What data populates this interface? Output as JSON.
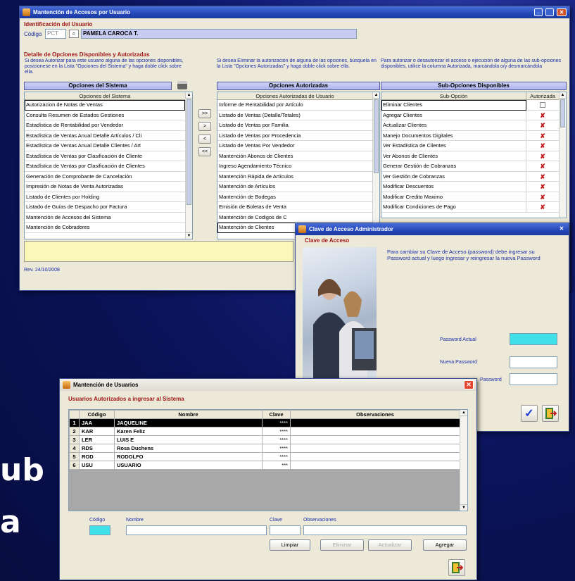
{
  "background": {
    "fragment1": "ub",
    "fragment2": "a"
  },
  "w1": {
    "title": "Mantención de Accesos por Usuario",
    "id_section": "Identificación del Usuario",
    "codigo_label": "Código",
    "codigo_value": "PCT",
    "user_name": "PAMELA CAROCA T.",
    "detail_section": "Detalle de Opciones Disponibles y Autorizadas",
    "help1": "Si desea Autorizar para este usuario alguna de las opciones disponibles, posicionese en la Lista \"Opciones del Sistema\" y haga doble click sobre ella.",
    "help2": "Si desea Eliminar la autorización de alguna de las opciones, búsquela en la Lista \"Opciones Autorizadas\" y haga doble click sobre ella.",
    "help3": "Para autorizar o desautorizar el acceso o ejecución de alguna de las sub-opciones disponibles, utilice la columna Autorizada, marcándola o/y desmarcándola",
    "hdr_sistema": "Opciones del Sistema",
    "hdr_autorizadas": "Opciones Autorizadas",
    "hdr_sub": "Sub-Opciones Disponibles",
    "col_sistema": "Opciones del Sistema",
    "col_aut": "Opciones Autorizadas de Usuario",
    "col_sub": "Sub-Opción",
    "col_autorizada": "Autorizada",
    "sistema": [
      "Autorizacion de Notas de Ventas",
      "Consulta Resumen de Estados Gestiones",
      "Estadística de Rentabilidad por Vendedor",
      "Estadística de Ventas Anual Detalle Artículos / Cli",
      "Estadística de Ventas Anual Detalle Clientes / Art",
      "Estadística de Ventas por Clasificación de Cliente",
      "Estadística de Ventas por Clasificación de Clientes",
      "Generación de Comprobante de Cancelación",
      "Impresión de Notas de Venta Autorizadas",
      "Listado de Clientes por Holding",
      "Listado de Guías de Despacho por Factura",
      "Mantención de Accesos del Sistema",
      "Mantención de Cobradores"
    ],
    "autorizadas": [
      "Informe de Rentabilidad por Artículo",
      "Listado de Ventas (Detalle/Totales)",
      "Listado de Ventas por Familia",
      "Listado de Ventas por Procedencia",
      "Listado de Ventas Por Vendedor",
      "Mantención Abonos de Clientes",
      "Ingreso Agendamiento Técnico",
      "Mantención Rápida de Artículos",
      "Mantención de Artículos",
      "Mantención de Bodegas",
      "Emisión de Boletas de Venta",
      "Mantención de Codigos de C",
      "Mantención de Clientes"
    ],
    "sub": [
      "Eliminar Clientes",
      "Agregar Clientes",
      "Actualizar Clientes",
      "Manejo Documentos Digitales",
      "Ver Estadística de Clientes",
      "Ver Abonos de Clientes",
      "Generar Gestión de Cobranzas",
      "Ver Gestión de Cobranzas",
      "Modificar Descuentos",
      "Modificar Credito Maximo",
      "Modificar Condiciones de Pago"
    ],
    "sub_mark": [
      "",
      "✘",
      "✘",
      "✘",
      "✘",
      "✘",
      "✘",
      "✘",
      "✘",
      "✘",
      "✘"
    ],
    "btn_all_add": ">>",
    "btn_add": ">",
    "btn_remove": "<",
    "btn_all_remove": "<<",
    "revision": "Rev. 24/10/2008"
  },
  "w2": {
    "title": "Clave de Acceso Administrador",
    "section": "Clave de Acceso",
    "instructions": "Para cambiar su Clave de Acceso (password) debe ingresar su Password actual y luego ingresar y reingresar la nueva Password",
    "lbl_actual": "Password Actual",
    "lbl_nueva": "Nueva Password",
    "lbl_repite": "Password"
  },
  "w3": {
    "title": "Mantención de Usuarios",
    "section": "Usuarios Autorizados a ingresar al Sistema",
    "cols": [
      "Código",
      "Nombre",
      "Clave",
      "Observaciones"
    ],
    "rows": [
      {
        "n": "1",
        "codigo": "JAA",
        "nombre": "JAQUELINE",
        "clave": "****",
        "obs": ""
      },
      {
        "n": "2",
        "codigo": "KAR",
        "nombre": "Karen Feliz",
        "clave": "****",
        "obs": ""
      },
      {
        "n": "3",
        "codigo": "LER",
        "nombre": "LUIS E",
        "clave": "****",
        "obs": ""
      },
      {
        "n": "4",
        "codigo": "RDS",
        "nombre": "Rosa Duchens",
        "clave": "****",
        "obs": ""
      },
      {
        "n": "5",
        "codigo": "ROD",
        "nombre": "RODOLFO",
        "clave": "****",
        "obs": ""
      },
      {
        "n": "6",
        "codigo": "USU",
        "nombre": "USUARIO",
        "clave": "***",
        "obs": ""
      }
    ],
    "lbl_codigo": "Código",
    "lbl_nombre": "Nombre",
    "lbl_clave": "Clave",
    "lbl_obs": "Observaciones",
    "btn_limpiar": "Limpiar",
    "btn_eliminar": "Eliminar",
    "btn_actualizar": "Actualizar",
    "btn_agregar": "Agregar"
  }
}
